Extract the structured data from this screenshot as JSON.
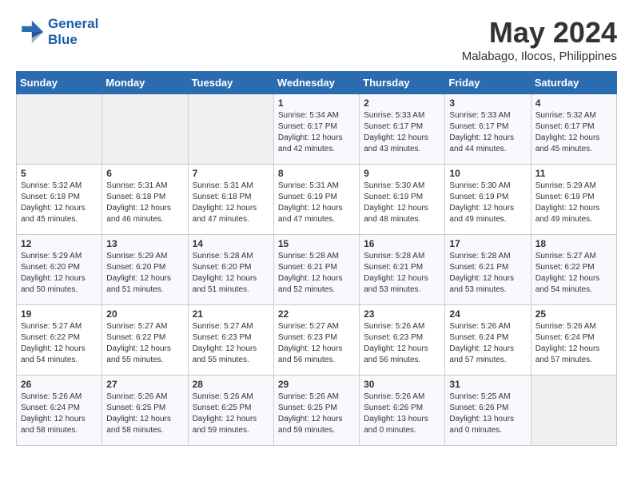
{
  "header": {
    "logo_line1": "General",
    "logo_line2": "Blue",
    "month": "May 2024",
    "location": "Malabago, Ilocos, Philippines"
  },
  "weekdays": [
    "Sunday",
    "Monday",
    "Tuesday",
    "Wednesday",
    "Thursday",
    "Friday",
    "Saturday"
  ],
  "weeks": [
    [
      {
        "day": "",
        "text": ""
      },
      {
        "day": "",
        "text": ""
      },
      {
        "day": "",
        "text": ""
      },
      {
        "day": "1",
        "text": "Sunrise: 5:34 AM\nSunset: 6:17 PM\nDaylight: 12 hours\nand 42 minutes."
      },
      {
        "day": "2",
        "text": "Sunrise: 5:33 AM\nSunset: 6:17 PM\nDaylight: 12 hours\nand 43 minutes."
      },
      {
        "day": "3",
        "text": "Sunrise: 5:33 AM\nSunset: 6:17 PM\nDaylight: 12 hours\nand 44 minutes."
      },
      {
        "day": "4",
        "text": "Sunrise: 5:32 AM\nSunset: 6:17 PM\nDaylight: 12 hours\nand 45 minutes."
      }
    ],
    [
      {
        "day": "5",
        "text": "Sunrise: 5:32 AM\nSunset: 6:18 PM\nDaylight: 12 hours\nand 45 minutes."
      },
      {
        "day": "6",
        "text": "Sunrise: 5:31 AM\nSunset: 6:18 PM\nDaylight: 12 hours\nand 46 minutes."
      },
      {
        "day": "7",
        "text": "Sunrise: 5:31 AM\nSunset: 6:18 PM\nDaylight: 12 hours\nand 47 minutes."
      },
      {
        "day": "8",
        "text": "Sunrise: 5:31 AM\nSunset: 6:19 PM\nDaylight: 12 hours\nand 47 minutes."
      },
      {
        "day": "9",
        "text": "Sunrise: 5:30 AM\nSunset: 6:19 PM\nDaylight: 12 hours\nand 48 minutes."
      },
      {
        "day": "10",
        "text": "Sunrise: 5:30 AM\nSunset: 6:19 PM\nDaylight: 12 hours\nand 49 minutes."
      },
      {
        "day": "11",
        "text": "Sunrise: 5:29 AM\nSunset: 6:19 PM\nDaylight: 12 hours\nand 49 minutes."
      }
    ],
    [
      {
        "day": "12",
        "text": "Sunrise: 5:29 AM\nSunset: 6:20 PM\nDaylight: 12 hours\nand 50 minutes."
      },
      {
        "day": "13",
        "text": "Sunrise: 5:29 AM\nSunset: 6:20 PM\nDaylight: 12 hours\nand 51 minutes."
      },
      {
        "day": "14",
        "text": "Sunrise: 5:28 AM\nSunset: 6:20 PM\nDaylight: 12 hours\nand 51 minutes."
      },
      {
        "day": "15",
        "text": "Sunrise: 5:28 AM\nSunset: 6:21 PM\nDaylight: 12 hours\nand 52 minutes."
      },
      {
        "day": "16",
        "text": "Sunrise: 5:28 AM\nSunset: 6:21 PM\nDaylight: 12 hours\nand 53 minutes."
      },
      {
        "day": "17",
        "text": "Sunrise: 5:28 AM\nSunset: 6:21 PM\nDaylight: 12 hours\nand 53 minutes."
      },
      {
        "day": "18",
        "text": "Sunrise: 5:27 AM\nSunset: 6:22 PM\nDaylight: 12 hours\nand 54 minutes."
      }
    ],
    [
      {
        "day": "19",
        "text": "Sunrise: 5:27 AM\nSunset: 6:22 PM\nDaylight: 12 hours\nand 54 minutes."
      },
      {
        "day": "20",
        "text": "Sunrise: 5:27 AM\nSunset: 6:22 PM\nDaylight: 12 hours\nand 55 minutes."
      },
      {
        "day": "21",
        "text": "Sunrise: 5:27 AM\nSunset: 6:23 PM\nDaylight: 12 hours\nand 55 minutes."
      },
      {
        "day": "22",
        "text": "Sunrise: 5:27 AM\nSunset: 6:23 PM\nDaylight: 12 hours\nand 56 minutes."
      },
      {
        "day": "23",
        "text": "Sunrise: 5:26 AM\nSunset: 6:23 PM\nDaylight: 12 hours\nand 56 minutes."
      },
      {
        "day": "24",
        "text": "Sunrise: 5:26 AM\nSunset: 6:24 PM\nDaylight: 12 hours\nand 57 minutes."
      },
      {
        "day": "25",
        "text": "Sunrise: 5:26 AM\nSunset: 6:24 PM\nDaylight: 12 hours\nand 57 minutes."
      }
    ],
    [
      {
        "day": "26",
        "text": "Sunrise: 5:26 AM\nSunset: 6:24 PM\nDaylight: 12 hours\nand 58 minutes."
      },
      {
        "day": "27",
        "text": "Sunrise: 5:26 AM\nSunset: 6:25 PM\nDaylight: 12 hours\nand 58 minutes."
      },
      {
        "day": "28",
        "text": "Sunrise: 5:26 AM\nSunset: 6:25 PM\nDaylight: 12 hours\nand 59 minutes."
      },
      {
        "day": "29",
        "text": "Sunrise: 5:26 AM\nSunset: 6:25 PM\nDaylight: 12 hours\nand 59 minutes."
      },
      {
        "day": "30",
        "text": "Sunrise: 5:26 AM\nSunset: 6:26 PM\nDaylight: 13 hours\nand 0 minutes."
      },
      {
        "day": "31",
        "text": "Sunrise: 5:25 AM\nSunset: 6:26 PM\nDaylight: 13 hours\nand 0 minutes."
      },
      {
        "day": "",
        "text": ""
      }
    ]
  ]
}
